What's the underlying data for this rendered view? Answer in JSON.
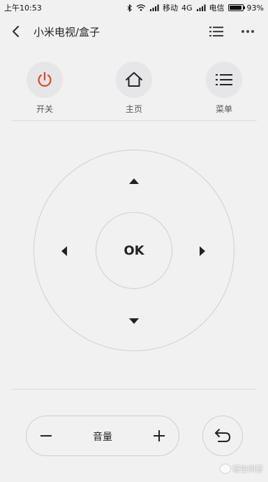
{
  "status_bar": {
    "time": "上午10:53",
    "carrier1": "移动",
    "network": "4G",
    "carrier2": "电信",
    "battery": "93%",
    "battery_level": 0.93,
    "icons": [
      "bluetooth-icon",
      "wifi-icon",
      "signal-icon",
      "signal-icon"
    ]
  },
  "header": {
    "title": "小米电视/盒子",
    "back_icon": "chevron-left-icon",
    "list_icon": "list-icon",
    "more_icon": "more-horizontal-icon"
  },
  "actions": [
    {
      "label": "开关",
      "icon": "power-icon",
      "color": "#d9472b"
    },
    {
      "label": "主页",
      "icon": "home-icon",
      "color": "#222222"
    },
    {
      "label": "菜单",
      "icon": "menu-icon",
      "color": "#222222"
    }
  ],
  "dpad": {
    "ok_label": "OK",
    "icons": [
      "arrow-up-icon",
      "arrow-down-icon",
      "arrow-left-icon",
      "arrow-right-icon"
    ]
  },
  "volume": {
    "label": "音量",
    "minus_icon": "minus-icon",
    "plus_icon": "plus-icon"
  },
  "back_button": {
    "icon": "return-icon"
  },
  "watermark": {
    "text": "悟空问答"
  },
  "colors": {
    "background": "#f1f1f2",
    "power_accent": "#d9472b",
    "circle_fill": "#e6e6e8",
    "outline": "#cfcfd2"
  }
}
